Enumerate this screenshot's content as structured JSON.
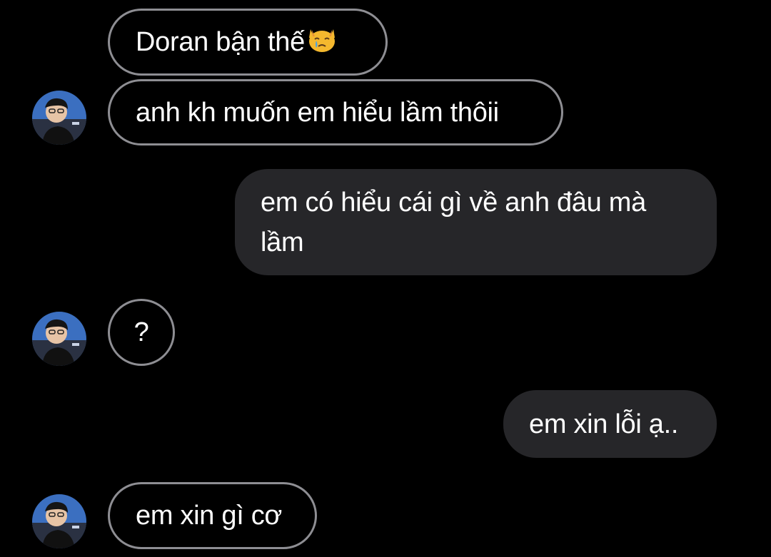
{
  "messages": [
    {
      "direction": "incoming",
      "text": "Doran bận thế",
      "emoji": "crying-cat-face"
    },
    {
      "direction": "incoming",
      "text": "anh kh muốn em hiểu lầm thôii"
    },
    {
      "direction": "outgoing",
      "text": "em có hiểu cái gì về anh đâu mà lầm"
    },
    {
      "direction": "incoming",
      "text": "?"
    },
    {
      "direction": "outgoing",
      "text": "em xin lỗi ạ.."
    },
    {
      "direction": "incoming",
      "text": "em xin gì cơ"
    }
  ],
  "colors": {
    "background": "#000000",
    "incoming_border": "#8e8e93",
    "outgoing_fill": "#262629",
    "text": "#ffffff"
  },
  "icons": {
    "avatar": "contact-avatar-photo"
  }
}
